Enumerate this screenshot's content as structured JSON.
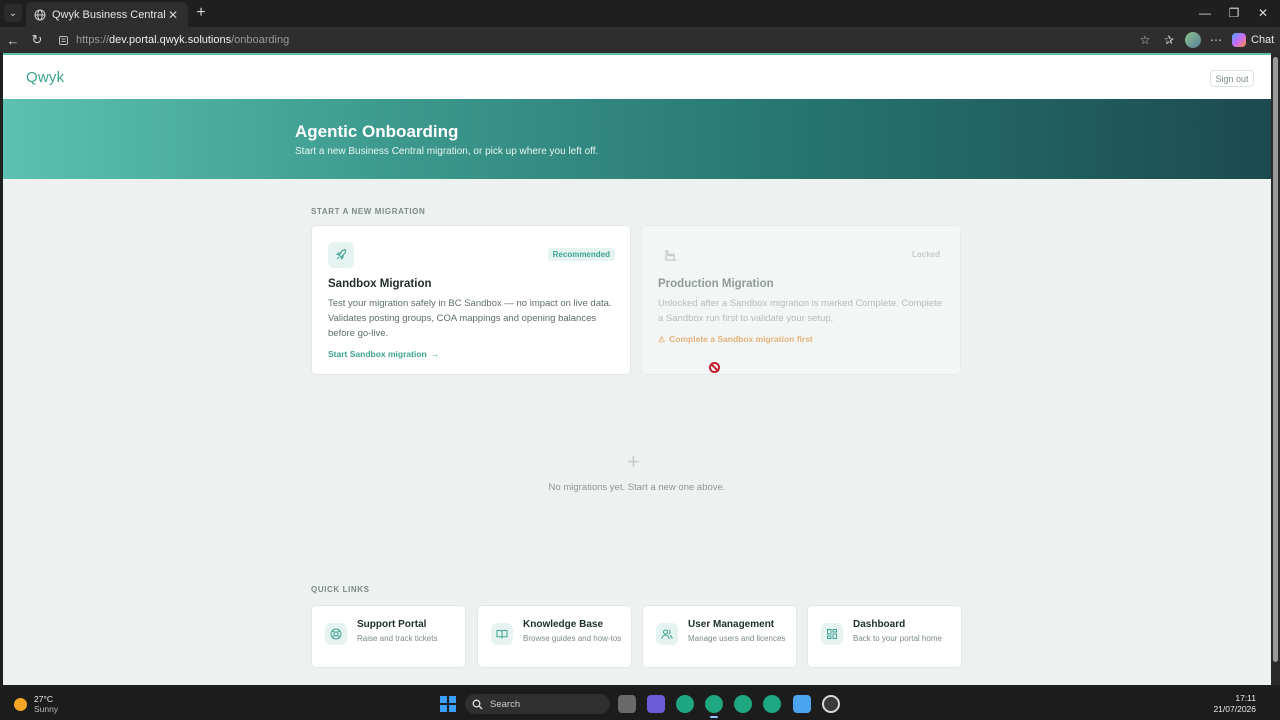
{
  "browser": {
    "tab_title": "Qwyk Business Central Portal",
    "url_protocol": "https://",
    "url_host": "dev.portal.qwyk.solutions",
    "url_path": "/onboarding",
    "chat_label": "Chat"
  },
  "header": {
    "brand": "Qwyk",
    "sign_out": "Sign out"
  },
  "hero": {
    "title": "Agentic Onboarding",
    "subtitle": "Start a new Business Central migration, or pick up where you left off."
  },
  "migration": {
    "section_label": "START A NEW MIGRATION",
    "sandbox": {
      "badge": "Recommended",
      "title": "Sandbox Migration",
      "description": "Test your migration safely in BC Sandbox — no impact on live data. Validates posting groups, COA mappings and opening balances before go-live.",
      "action": "Start Sandbox migration"
    },
    "production": {
      "badge": "Locked",
      "title": "Production Migration",
      "description": "Unlocked after a Sandbox migration is marked Complete. Complete a Sandbox run first to validate your setup.",
      "action": "Complete a Sandbox migration first"
    }
  },
  "empty_state": {
    "text": "No migrations yet. Start a new one above."
  },
  "quick_links": {
    "section_label": "QUICK LINKS",
    "items": [
      {
        "title": "Support Portal",
        "description": "Raise and track tickets",
        "icon": "lifebuoy-icon"
      },
      {
        "title": "Knowledge Base",
        "description": "Browse guides and how-tos",
        "icon": "book-icon"
      },
      {
        "title": "User Management",
        "description": "Manage users and licences",
        "icon": "users-icon"
      },
      {
        "title": "Dashboard",
        "description": "Back to your portal home",
        "icon": "dashboard-icon"
      }
    ]
  },
  "taskbar": {
    "temperature": "27°C",
    "weather": "Sunny",
    "search_placeholder": "Search",
    "time": "17:11",
    "date": "21/07/2026"
  },
  "colors": {
    "accent": "#3da390",
    "hero_start": "#5cc1b0",
    "hero_end": "#1c4a50",
    "warning": "#e3b27a"
  }
}
